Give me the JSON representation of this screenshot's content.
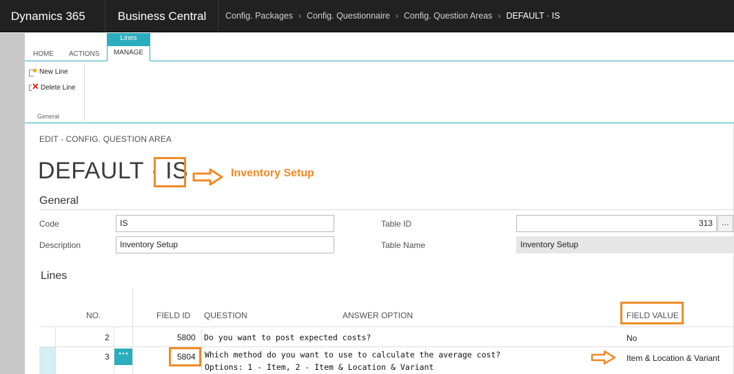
{
  "topbar": {
    "app_name": "Dynamics 365",
    "product_name": "Business Central",
    "breadcrumbs": [
      "Config. Packages",
      "Config. Questionnaire",
      "Config. Question Areas",
      "DEFAULT · IS"
    ]
  },
  "ribbon": {
    "contextual_tab_group": "Lines",
    "tabs": [
      "HOME",
      "ACTIONS",
      "MANAGE"
    ],
    "actions": {
      "new_line": "New Line",
      "delete_line": "Delete Line"
    },
    "group_label": "General"
  },
  "page": {
    "caption": "EDIT - CONFIG. QUESTION AREA",
    "title": "DEFAULT · IS",
    "annotation": "Inventory Setup"
  },
  "general": {
    "section_title": "General",
    "code_label": "Code",
    "code_value": "IS",
    "description_label": "Description",
    "description_value": "Inventory Setup",
    "table_id_label": "Table ID",
    "table_id_value": "313",
    "table_name_label": "Table Name",
    "table_name_value": "Inventory Setup",
    "lookup_label": "..."
  },
  "lines": {
    "section_title": "Lines",
    "columns": {
      "no": "NO.",
      "field_id": "FIELD ID",
      "question": "QUESTION",
      "answer_option": "ANSWER OPTION",
      "field_value": "FIELD VALUE"
    },
    "rows": [
      {
        "no": "2",
        "field_id": "5800",
        "question": "Do you want to post expected costs?",
        "answer_option": "",
        "field_value": "No"
      },
      {
        "no": "3",
        "field_id": "5804",
        "question": "Which method do you want to use to calculate the average cost?",
        "answer_option_line": "Options: 1 - Item, 2 - Item & Location & Variant",
        "field_value": "Item & Location & Variant",
        "menu_glyph": "···"
      }
    ]
  },
  "colors": {
    "accent": "#2aaebd",
    "annotation": "#f08a24",
    "topbar": "#212121"
  }
}
